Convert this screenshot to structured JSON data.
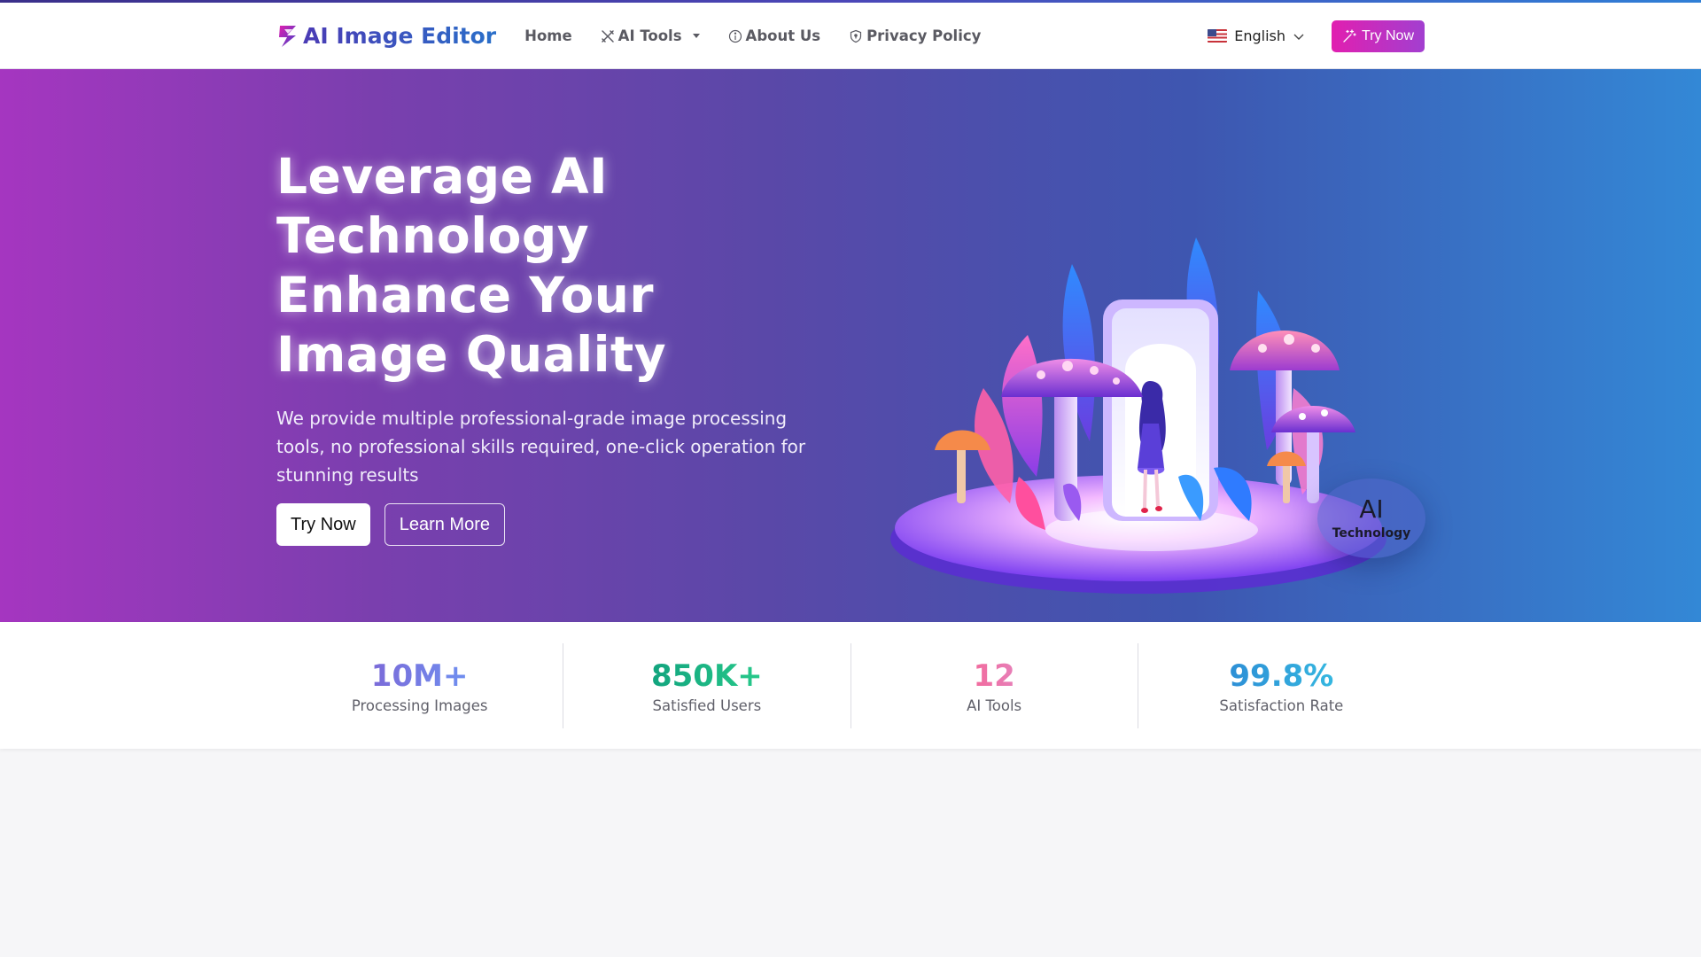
{
  "navbar": {
    "brand": "AI Image Editor",
    "links": [
      {
        "label": "Home",
        "icon": "none"
      },
      {
        "label": "AI Tools",
        "icon": "tools-icon",
        "dropdown": true
      },
      {
        "label": "About Us",
        "icon": "info-icon"
      },
      {
        "label": "Privacy Policy",
        "icon": "shield-icon"
      }
    ],
    "language": "English",
    "try_label": "Try Now"
  },
  "hero": {
    "title_lines": [
      "Leverage AI",
      "Technology",
      "Enhance Your",
      "Image Quality"
    ],
    "subtitle": "We provide multiple professional-grade image processing tools, no professional skills required, one-click operation for stunning results",
    "primary_button": "Try Now",
    "secondary_button": "Learn More",
    "badge": {
      "big": "AI",
      "small": "Technology"
    }
  },
  "stats": [
    {
      "value": "10M+",
      "label": "Processing Images"
    },
    {
      "value": "850K+",
      "label": "Satisfied Users"
    },
    {
      "value": "12",
      "label": "AI Tools"
    },
    {
      "value": "99.8%",
      "label": "Satisfaction Rate"
    }
  ],
  "colors": {
    "brand": "#4a3bb5",
    "accent": "#e11fb0",
    "hero_left": "#a536c0",
    "hero_right": "#3388d6"
  }
}
